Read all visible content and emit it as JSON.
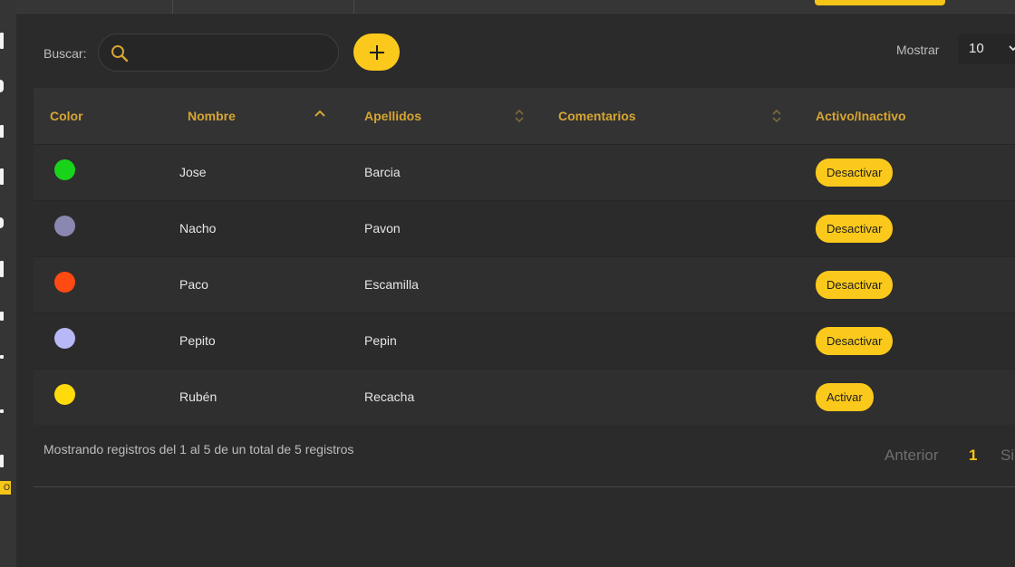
{
  "toolbar": {
    "search_label": "Buscar:",
    "search_value": "",
    "mostrar_label": "Mostrar",
    "mostrar_value": "10"
  },
  "table": {
    "headers": [
      "Color",
      "Nombre",
      "Apellidos",
      "Comentarios",
      "Activo/Inactivo"
    ],
    "rows": [
      {
        "color": "#19d31a",
        "nombre": "Jose",
        "apellidos": "Barcia",
        "comentarios": "",
        "action": "Desactivar"
      },
      {
        "color": "#8a87b0",
        "nombre": "Nacho",
        "apellidos": "Pavon",
        "comentarios": "",
        "action": "Desactivar"
      },
      {
        "color": "#ff4a12",
        "nombre": "Paco",
        "apellidos": "Escamilla",
        "comentarios": "",
        "action": "Desactivar"
      },
      {
        "color": "#b9b8f6",
        "nombre": "Pepito",
        "apellidos": "Pepin",
        "comentarios": "",
        "action": "Desactivar"
      },
      {
        "color": "#ffdb0c",
        "nombre": "Rubén",
        "apellidos": "Recacha",
        "comentarios": "",
        "action": "Activar"
      }
    ]
  },
  "footer": {
    "info": "Mostrando registros del 1 al 5 de un total de 5 registros",
    "prev_label": "Anterior",
    "current_page": "1",
    "next_label": "Si"
  },
  "sidebar": {
    "badge": "O"
  },
  "colors": {
    "accent": "#fbc91c",
    "header_text": "#d6a532",
    "background": "#2b2b2b"
  }
}
